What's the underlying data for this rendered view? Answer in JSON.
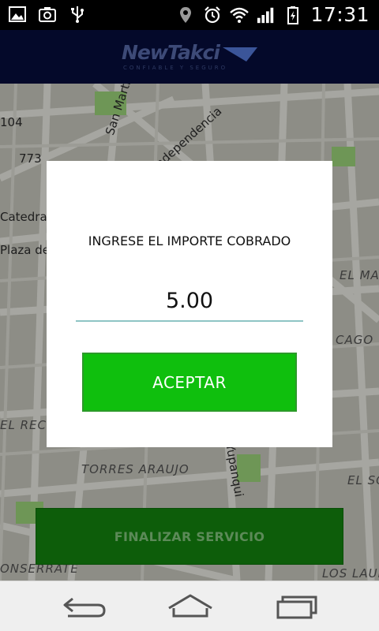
{
  "status_bar": {
    "time": "17:31",
    "icons": [
      "image-icon",
      "camera-icon",
      "usb-icon",
      "location-icon",
      "alarm-icon",
      "wifi-icon",
      "signal-icon",
      "battery-charging-icon"
    ]
  },
  "header": {
    "logo_text": "NewTakci",
    "logo_tagline": "CONFIABLE Y SEGURO"
  },
  "map": {
    "labels": [
      "104",
      "773",
      "San Martin",
      "Independencia",
      "Catedral de",
      "Plaza de",
      "EL MAYO",
      "CAGO",
      "EL RECRE",
      "TORRES ARAUJO",
      "Yupanqui",
      "EL SO",
      "ONSERRATE",
      "LOS LAUR"
    ],
    "colors": {
      "background": "#8d8d86",
      "roads": "#a9a9a4",
      "parks": "#6f9a55"
    }
  },
  "dialog": {
    "title": "INGRESE EL IMPORTE COBRADO",
    "amount_value": "5.00",
    "accept_label": "ACEPTAR",
    "accent_color": "#0fbf0d"
  },
  "finalize_button": {
    "label": "FINALIZAR SERVICIO"
  },
  "nav_bar": {
    "items": [
      "back-icon",
      "home-icon",
      "recents-icon"
    ]
  }
}
